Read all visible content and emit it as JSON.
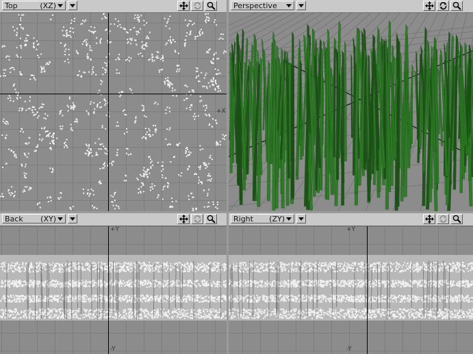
{
  "viewports": {
    "top": {
      "view_name": "Top",
      "axes": "(XZ)"
    },
    "perspective": {
      "view_name": "Perspective",
      "axes": ""
    },
    "back": {
      "view_name": "Back",
      "axes": "(XY)",
      "axis_plus": "+Y",
      "axis_minus": "-Y"
    },
    "right": {
      "view_name": "Right",
      "axes": "(ZY)",
      "axis_plus": "+Y",
      "axis_minus": "-Y"
    }
  },
  "top_axis_hint": "+X",
  "icons": {
    "move": "move-view-icon",
    "rotate": "rotate-view-icon",
    "zoom": "zoom-view-icon",
    "dropdown": "chevron-down-icon"
  },
  "colors": {
    "grass": "#2c7a24",
    "grass_dark": "#1b4f16",
    "viewport_bg": "#8c8c8c",
    "header_bg": "#c9c9c9",
    "points": "#f2f2f2",
    "axis": "#000000"
  }
}
